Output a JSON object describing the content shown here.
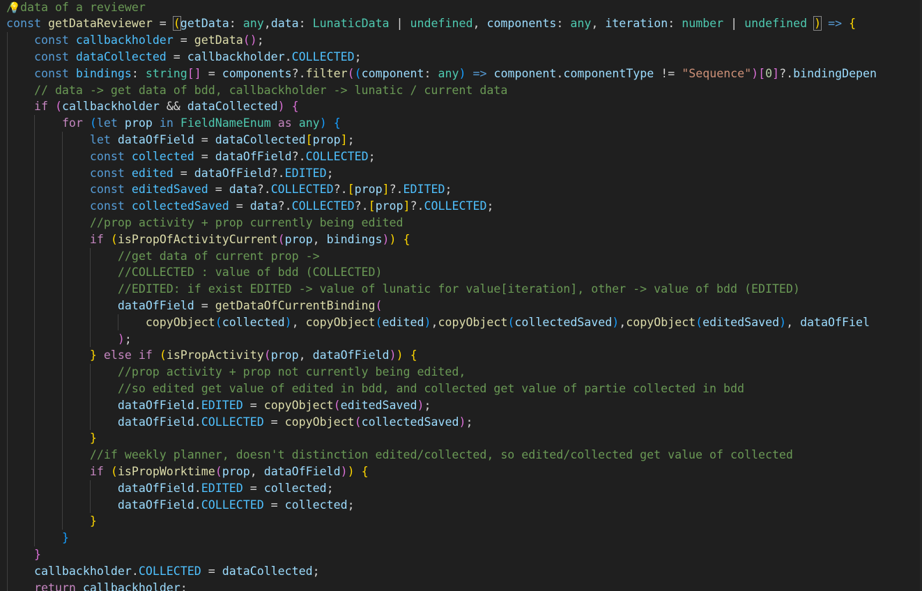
{
  "editor": {
    "language": "typescript",
    "theme": "dark",
    "lightbulb_icon": "lightbulb-icon",
    "colors": {
      "background": "#1f1f1f",
      "keyword": "#569cd6",
      "control": "#c586c0",
      "variable": "#9cdcfe",
      "constant": "#4fc1ff",
      "function": "#dcdcaa",
      "type": "#4ec9b0",
      "string": "#ce9178",
      "number": "#b5cea8",
      "comment": "#6a9955"
    },
    "lines": [
      [
        [
          "cmt",
          "/"
        ],
        [
          "cmt",
          " data of a reviewer"
        ]
      ],
      [
        [
          "kw",
          "const "
        ],
        [
          "fn",
          "getDataReviewer"
        ],
        [
          "op",
          " = "
        ],
        [
          "bmatch",
          "("
        ],
        [
          "var",
          "getData"
        ],
        [
          "op",
          ": "
        ],
        [
          "type",
          "any"
        ],
        [
          "op",
          ","
        ],
        [
          "var",
          "data"
        ],
        [
          "op",
          ": "
        ],
        [
          "type",
          "LunaticData"
        ],
        [
          "op",
          " | "
        ],
        [
          "type",
          "undefined"
        ],
        [
          "op",
          ", "
        ],
        [
          "var",
          "components"
        ],
        [
          "op",
          ": "
        ],
        [
          "type",
          "any"
        ],
        [
          "op",
          ", "
        ],
        [
          "var",
          "iteration"
        ],
        [
          "op",
          ": "
        ],
        [
          "type",
          "number"
        ],
        [
          "op",
          " | "
        ],
        [
          "type",
          "undefined"
        ],
        [
          "op",
          " "
        ],
        [
          "bmatch",
          ")"
        ],
        [
          "op",
          " "
        ],
        [
          "kw",
          "=>"
        ],
        [
          "op",
          " "
        ],
        [
          "b1",
          "{"
        ]
      ],
      [
        [
          "op",
          "    "
        ],
        [
          "kw",
          "const "
        ],
        [
          "const",
          "callbackholder"
        ],
        [
          "op",
          " = "
        ],
        [
          "fn",
          "getData"
        ],
        [
          "b2",
          "()"
        ],
        [
          "op",
          ";"
        ]
      ],
      [
        [
          "op",
          "    "
        ],
        [
          "kw",
          "const "
        ],
        [
          "const",
          "dataCollected"
        ],
        [
          "op",
          " = "
        ],
        [
          "var",
          "callbackholder"
        ],
        [
          "op",
          "."
        ],
        [
          "const",
          "COLLECTED"
        ],
        [
          "op",
          ";"
        ]
      ],
      [
        [
          "op",
          "    "
        ],
        [
          "kw",
          "const "
        ],
        [
          "const",
          "bindings"
        ],
        [
          "op",
          ": "
        ],
        [
          "type",
          "string"
        ],
        [
          "b2",
          "[]"
        ],
        [
          "op",
          " = "
        ],
        [
          "var",
          "components"
        ],
        [
          "op",
          "?."
        ],
        [
          "fn",
          "filter"
        ],
        [
          "b2",
          "("
        ],
        [
          "b3",
          "("
        ],
        [
          "var",
          "component"
        ],
        [
          "op",
          ": "
        ],
        [
          "type",
          "any"
        ],
        [
          "b3",
          ")"
        ],
        [
          "op",
          " "
        ],
        [
          "kw",
          "=>"
        ],
        [
          "op",
          " "
        ],
        [
          "var",
          "component"
        ],
        [
          "op",
          "."
        ],
        [
          "var",
          "componentType"
        ],
        [
          "op",
          " != "
        ],
        [
          "str",
          "\"Sequence\""
        ],
        [
          "b2",
          ")"
        ],
        [
          "b2",
          "["
        ],
        [
          "num",
          "0"
        ],
        [
          "b2",
          "]"
        ],
        [
          "op",
          "?."
        ],
        [
          "var",
          "bindingDepen"
        ]
      ],
      [
        [
          "op",
          "    "
        ],
        [
          "cmt",
          "// data -> get data of bdd, callbackholder -> lunatic / current data"
        ]
      ],
      [
        [
          "op",
          "    "
        ],
        [
          "ctrl",
          "if"
        ],
        [
          "op",
          " "
        ],
        [
          "b2",
          "("
        ],
        [
          "var",
          "callbackholder"
        ],
        [
          "op",
          " && "
        ],
        [
          "var",
          "dataCollected"
        ],
        [
          "b2",
          ")"
        ],
        [
          "op",
          " "
        ],
        [
          "b2",
          "{"
        ]
      ],
      [
        [
          "op",
          "        "
        ],
        [
          "ctrl",
          "for"
        ],
        [
          "op",
          " "
        ],
        [
          "b3",
          "("
        ],
        [
          "kw",
          "let "
        ],
        [
          "var",
          "prop"
        ],
        [
          "op",
          " "
        ],
        [
          "kw",
          "in "
        ],
        [
          "type",
          "FieldNameEnum"
        ],
        [
          "op",
          " "
        ],
        [
          "ctrl",
          "as"
        ],
        [
          "op",
          " "
        ],
        [
          "type",
          "any"
        ],
        [
          "b3",
          ")"
        ],
        [
          "op",
          " "
        ],
        [
          "b3",
          "{"
        ]
      ],
      [
        [
          "op",
          "            "
        ],
        [
          "kw",
          "let "
        ],
        [
          "var",
          "dataOfField"
        ],
        [
          "op",
          " = "
        ],
        [
          "var",
          "dataCollected"
        ],
        [
          "b1",
          "["
        ],
        [
          "var",
          "prop"
        ],
        [
          "b1",
          "]"
        ],
        [
          "op",
          ";"
        ]
      ],
      [
        [
          "op",
          "            "
        ],
        [
          "kw",
          "const "
        ],
        [
          "const",
          "collected"
        ],
        [
          "op",
          " = "
        ],
        [
          "var",
          "dataOfField"
        ],
        [
          "op",
          "?."
        ],
        [
          "const",
          "COLLECTED"
        ],
        [
          "op",
          ";"
        ]
      ],
      [
        [
          "op",
          "            "
        ],
        [
          "kw",
          "const "
        ],
        [
          "const",
          "edited"
        ],
        [
          "op",
          " = "
        ],
        [
          "var",
          "dataOfField"
        ],
        [
          "op",
          "?."
        ],
        [
          "const",
          "EDITED"
        ],
        [
          "op",
          ";"
        ]
      ],
      [
        [
          "op",
          "            "
        ],
        [
          "kw",
          "const "
        ],
        [
          "const",
          "editedSaved"
        ],
        [
          "op",
          " = "
        ],
        [
          "var",
          "data"
        ],
        [
          "op",
          "?."
        ],
        [
          "const",
          "COLLECTED"
        ],
        [
          "op",
          "?."
        ],
        [
          "b1",
          "["
        ],
        [
          "var",
          "prop"
        ],
        [
          "b1",
          "]"
        ],
        [
          "op",
          "?."
        ],
        [
          "const",
          "EDITED"
        ],
        [
          "op",
          ";"
        ]
      ],
      [
        [
          "op",
          "            "
        ],
        [
          "kw",
          "const "
        ],
        [
          "const",
          "collectedSaved"
        ],
        [
          "op",
          " = "
        ],
        [
          "var",
          "data"
        ],
        [
          "op",
          "?."
        ],
        [
          "const",
          "COLLECTED"
        ],
        [
          "op",
          "?."
        ],
        [
          "b1",
          "["
        ],
        [
          "var",
          "prop"
        ],
        [
          "b1",
          "]"
        ],
        [
          "op",
          "?."
        ],
        [
          "const",
          "COLLECTED"
        ],
        [
          "op",
          ";"
        ]
      ],
      [
        [
          "op",
          "            "
        ],
        [
          "cmt",
          "//prop activity + prop currently being edited"
        ]
      ],
      [
        [
          "op",
          "            "
        ],
        [
          "ctrl",
          "if"
        ],
        [
          "op",
          " "
        ],
        [
          "b1",
          "("
        ],
        [
          "fn",
          "isPropOfActivityCurrent"
        ],
        [
          "b2",
          "("
        ],
        [
          "var",
          "prop"
        ],
        [
          "op",
          ", "
        ],
        [
          "var",
          "bindings"
        ],
        [
          "b2",
          ")"
        ],
        [
          "b1",
          ")"
        ],
        [
          "op",
          " "
        ],
        [
          "b1",
          "{"
        ]
      ],
      [
        [
          "op",
          "                "
        ],
        [
          "cmt",
          "//get data of current prop ->"
        ]
      ],
      [
        [
          "op",
          "                "
        ],
        [
          "cmt",
          "//COLLECTED : value of bdd (COLLECTED)"
        ]
      ],
      [
        [
          "op",
          "                "
        ],
        [
          "cmt",
          "//EDITED: if exist EDITED -> value of lunatic for value[iteration], other -> value of bdd (EDITED)"
        ]
      ],
      [
        [
          "op",
          "                "
        ],
        [
          "var",
          "dataOfField"
        ],
        [
          "op",
          " = "
        ],
        [
          "fn",
          "getDataOfCurrentBinding"
        ],
        [
          "b2",
          "("
        ]
      ],
      [
        [
          "op",
          "                    "
        ],
        [
          "fn",
          "copyObject"
        ],
        [
          "b3",
          "("
        ],
        [
          "var",
          "collected"
        ],
        [
          "b3",
          ")"
        ],
        [
          "op",
          ", "
        ],
        [
          "fn",
          "copyObject"
        ],
        [
          "b3",
          "("
        ],
        [
          "var",
          "edited"
        ],
        [
          "b3",
          ")"
        ],
        [
          "op",
          ","
        ],
        [
          "fn",
          "copyObject"
        ],
        [
          "b3",
          "("
        ],
        [
          "var",
          "collectedSaved"
        ],
        [
          "b3",
          ")"
        ],
        [
          "op",
          ","
        ],
        [
          "fn",
          "copyObject"
        ],
        [
          "b3",
          "("
        ],
        [
          "var",
          "editedSaved"
        ],
        [
          "b3",
          ")"
        ],
        [
          "op",
          ", "
        ],
        [
          "var",
          "dataOfFiel"
        ]
      ],
      [
        [
          "op",
          "                "
        ],
        [
          "b2",
          ")"
        ],
        [
          "op",
          ";"
        ]
      ],
      [
        [
          "op",
          "            "
        ],
        [
          "b1",
          "}"
        ],
        [
          "op",
          " "
        ],
        [
          "ctrl",
          "else if"
        ],
        [
          "op",
          " "
        ],
        [
          "b1",
          "("
        ],
        [
          "fn",
          "isPropActivity"
        ],
        [
          "b2",
          "("
        ],
        [
          "var",
          "prop"
        ],
        [
          "op",
          ", "
        ],
        [
          "var",
          "dataOfField"
        ],
        [
          "b2",
          ")"
        ],
        [
          "b1",
          ")"
        ],
        [
          "op",
          " "
        ],
        [
          "b1",
          "{"
        ]
      ],
      [
        [
          "op",
          "                "
        ],
        [
          "cmt",
          "//prop activity + prop not currently being edited,"
        ]
      ],
      [
        [
          "op",
          "                "
        ],
        [
          "cmt",
          "//so edited get value of edited in bdd, and collected get value of partie collected in bdd"
        ]
      ],
      [
        [
          "op",
          "                "
        ],
        [
          "var",
          "dataOfField"
        ],
        [
          "op",
          "."
        ],
        [
          "const",
          "EDITED"
        ],
        [
          "op",
          " = "
        ],
        [
          "fn",
          "copyObject"
        ],
        [
          "b2",
          "("
        ],
        [
          "var",
          "editedSaved"
        ],
        [
          "b2",
          ")"
        ],
        [
          "op",
          ";"
        ]
      ],
      [
        [
          "op",
          "                "
        ],
        [
          "var",
          "dataOfField"
        ],
        [
          "op",
          "."
        ],
        [
          "const",
          "COLLECTED"
        ],
        [
          "op",
          " = "
        ],
        [
          "fn",
          "copyObject"
        ],
        [
          "b2",
          "("
        ],
        [
          "var",
          "collectedSaved"
        ],
        [
          "b2",
          ")"
        ],
        [
          "op",
          ";"
        ]
      ],
      [
        [
          "op",
          "            "
        ],
        [
          "b1",
          "}"
        ]
      ],
      [
        [
          "op",
          "            "
        ],
        [
          "cmt",
          "//if weekly planner, doesn't distinction edited/collected, so edited/collected get value of collected"
        ]
      ],
      [
        [
          "op",
          "            "
        ],
        [
          "ctrl",
          "if"
        ],
        [
          "op",
          " "
        ],
        [
          "b1",
          "("
        ],
        [
          "fn",
          "isPropWorktime"
        ],
        [
          "b2",
          "("
        ],
        [
          "var",
          "prop"
        ],
        [
          "op",
          ", "
        ],
        [
          "var",
          "dataOfField"
        ],
        [
          "b2",
          ")"
        ],
        [
          "b1",
          ")"
        ],
        [
          "op",
          " "
        ],
        [
          "b1",
          "{"
        ]
      ],
      [
        [
          "op",
          "                "
        ],
        [
          "var",
          "dataOfField"
        ],
        [
          "op",
          "."
        ],
        [
          "const",
          "EDITED"
        ],
        [
          "op",
          " = "
        ],
        [
          "var",
          "collected"
        ],
        [
          "op",
          ";"
        ]
      ],
      [
        [
          "op",
          "                "
        ],
        [
          "var",
          "dataOfField"
        ],
        [
          "op",
          "."
        ],
        [
          "const",
          "COLLECTED"
        ],
        [
          "op",
          " = "
        ],
        [
          "var",
          "collected"
        ],
        [
          "op",
          ";"
        ]
      ],
      [
        [
          "op",
          "            "
        ],
        [
          "b1",
          "}"
        ]
      ],
      [
        [
          "op",
          "        "
        ],
        [
          "b3",
          "}"
        ]
      ],
      [
        [
          "op",
          "    "
        ],
        [
          "b2",
          "}"
        ]
      ],
      [
        [
          "op",
          "    "
        ],
        [
          "var",
          "callbackholder"
        ],
        [
          "op",
          "."
        ],
        [
          "const",
          "COLLECTED"
        ],
        [
          "op",
          " = "
        ],
        [
          "var",
          "dataCollected"
        ],
        [
          "op",
          ";"
        ]
      ],
      [
        [
          "op",
          "    "
        ],
        [
          "ctrl",
          "return"
        ],
        [
          "op",
          " "
        ],
        [
          "var",
          "callbackholder"
        ],
        [
          "op",
          ";"
        ]
      ]
    ]
  }
}
